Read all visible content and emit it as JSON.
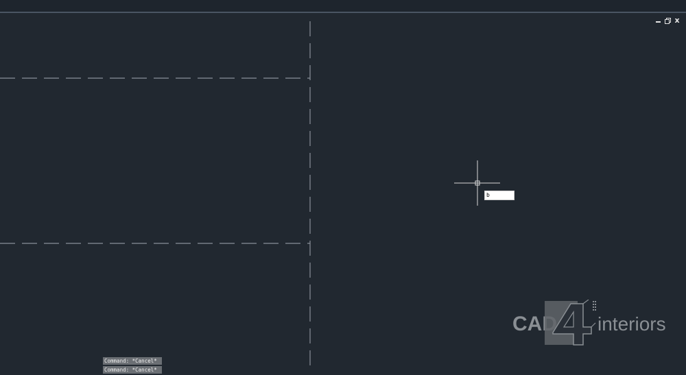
{
  "window_controls": {
    "minimize_icon": "minimize-icon",
    "restore_icon": "restore-icon",
    "close_label": "x"
  },
  "dynamic_input": {
    "value": "b"
  },
  "command_history": [
    "Command: *Cancel*",
    "Command: *Cancel*"
  ],
  "watermark": {
    "text_left": "CAD",
    "text_right": "interiors"
  },
  "colors": {
    "background": "#212830",
    "dashed_lines": "#8a9099",
    "crosshair": "#d9d9d9",
    "logo": "#8a8f94"
  }
}
